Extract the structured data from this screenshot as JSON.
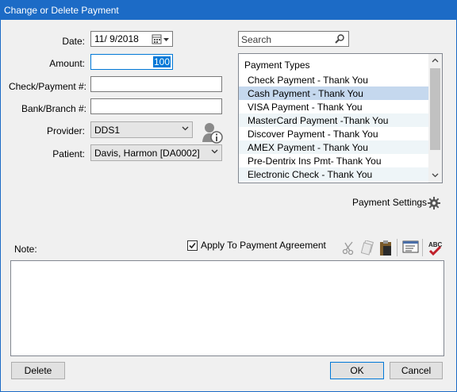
{
  "window": {
    "title": "Change or Delete Payment"
  },
  "form": {
    "date_label": "Date:",
    "date_value": "11/ 9/2018",
    "amount_label": "Amount:",
    "amount_value": "100",
    "check_label": "Check/Payment #:",
    "check_value": "",
    "bank_label": "Bank/Branch #:",
    "bank_value": "",
    "provider_label": "Provider:",
    "provider_value": "DDS1",
    "patient_label": "Patient:",
    "patient_value": "Davis, Harmon [DA0002]"
  },
  "search": {
    "placeholder": "Search"
  },
  "payment_types": {
    "header": "Payment Types",
    "items": [
      "Check Payment - Thank You",
      "Cash Payment - Thank You",
      "VISA Payment - Thank You",
      "MasterCard Payment -Thank You",
      "Discover Payment - Thank You",
      "AMEX Payment - Thank You",
      "Pre-Dentrix Ins Pmt- Thank You",
      "Electronic Check - Thank You"
    ],
    "selected_index": 1
  },
  "payment_settings_label": "Payment Settings",
  "note_label": "Note:",
  "apply_agreement": {
    "label": "Apply To Payment Agreement",
    "checked": true
  },
  "buttons": {
    "delete": "Delete",
    "ok": "OK",
    "cancel": "Cancel"
  },
  "colors": {
    "titlebar": "#1c6bc6",
    "selected_row": "#c5d8ee",
    "alt_row": "#eef5f8",
    "spell_check": "#c0202a"
  }
}
